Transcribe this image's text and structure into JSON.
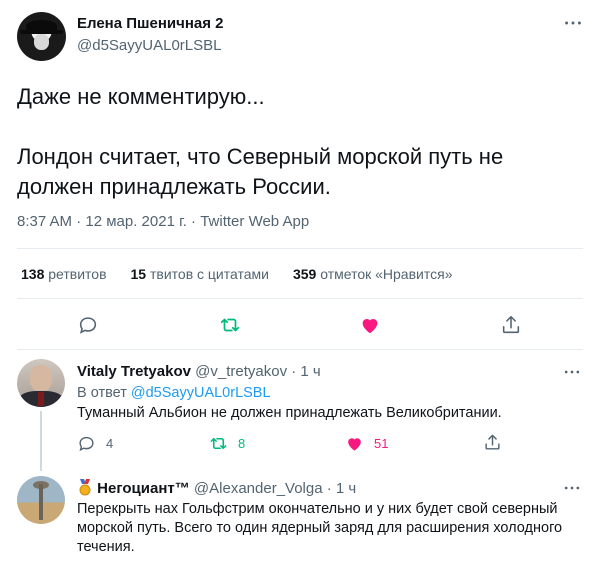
{
  "tweet": {
    "author_name": "Елена Пшеничная 2",
    "author_handle": "@d5SayyUAL0rLSBL",
    "text_line1": "Даже не комментирую...",
    "text_line2": "Лондон считает, что Северный морской путь не",
    "text_line3": "должен принадлежать России.",
    "meta": "8:37 AM · 12 мар. 2021 г. · Twitter Web App",
    "stats": {
      "retweets_count": "138",
      "retweets_label": "ретвитов",
      "quotes_count": "15",
      "quotes_label": "твитов с цитатами",
      "likes_count": "359",
      "likes_label": "отметок «Нравится»"
    },
    "more_icon": "more-icon",
    "actions": [
      "reply-icon",
      "retweet-icon",
      "like-icon",
      "share-icon"
    ]
  },
  "replies": [
    {
      "name": "Vitaly Tretyakov",
      "handle_time": "@v_tretyakov · 1 ч",
      "reply_to_prefix": "В ответ",
      "reply_to_handle": "@d5SayyUAL0rLSBL",
      "text": "Туманный Альбион не должен принадлежать Великобритании.",
      "reply_count": "4",
      "retweet_count": "8",
      "like_count": "51"
    },
    {
      "name": "Негоциант™",
      "handle_time": "@Alexander_Volga · 1 ч",
      "badge_icon": "medal-icon",
      "text": "Перекрыть нах Гольфстрим окончательно и у них будет свой северный морской путь. Всего то один ядерный заряд для расширения холодного течения."
    }
  ],
  "colors": {
    "text": "#0f1419",
    "secondary": "#536471",
    "link": "#1d9bf0",
    "retweet_green": "#00ba7c",
    "like_red": "#f91880",
    "divider": "#e6ecf0"
  }
}
